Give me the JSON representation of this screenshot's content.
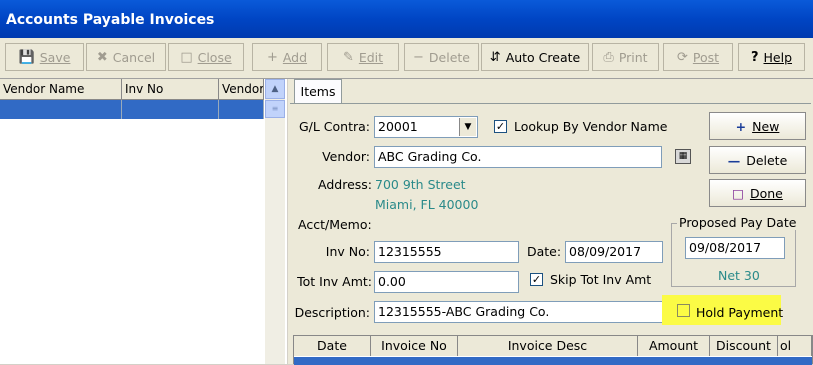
{
  "window": {
    "title": "Accounts Payable Invoices"
  },
  "toolbar": {
    "buttons": [
      {
        "label": "Save",
        "icon": "floppy-icon",
        "enabled": false
      },
      {
        "label": "Cancel",
        "icon": "cancel-x-icon",
        "enabled": false
      },
      {
        "label": "Close",
        "icon": "door-exit-icon",
        "enabled": false
      },
      {
        "label": "Add",
        "icon": "plus-icon",
        "enabled": false
      },
      {
        "label": "Edit",
        "icon": "edit-icon",
        "enabled": false
      },
      {
        "label": "Delete",
        "icon": "minus-icon",
        "enabled": false
      },
      {
        "label": "Auto Create",
        "icon": "auto-create-icon",
        "enabled": true
      },
      {
        "label": "Print",
        "icon": "printer-icon",
        "enabled": false
      },
      {
        "label": "Post",
        "icon": "post-icon",
        "enabled": false
      },
      {
        "label": "Help",
        "icon": "question-icon",
        "enabled": true
      }
    ]
  },
  "list": {
    "columns": [
      "Vendor Name",
      "Inv No",
      "Vendor"
    ]
  },
  "tabs": [
    "Items"
  ],
  "form": {
    "gl_contra_label": "G/L Contra:",
    "gl_contra_value": "20001",
    "lookup_label": "Lookup By Vendor Name",
    "lookup_checked": true,
    "vendor_label": "Vendor:",
    "vendor_value": "ABC Grading Co.",
    "address_label": "Address:",
    "address_line1": "700 9th Street",
    "address_line2": "Miami, FL 40000",
    "acct_memo_label": "Acct/Memo:",
    "inv_no_label": "Inv No:",
    "inv_no_value": "12315555",
    "date_label": "Date:",
    "date_value": "08/09/2017",
    "tot_inv_amt_label": "Tot Inv Amt:",
    "tot_inv_amt_value": "0.00",
    "skip_label": "Skip Tot Inv Amt",
    "skip_checked": true,
    "description_label": "Description:",
    "description_value": "12315555-ABC Grading Co.",
    "hold_label": "Hold Payment",
    "hold_checked": false
  },
  "side_buttons": {
    "new": "New",
    "delete": "Delete",
    "done": "Done"
  },
  "proposed": {
    "title": "Proposed Pay Date",
    "date": "09/08/2017",
    "terms": "Net 30"
  },
  "items_grid": {
    "columns": [
      "Date",
      "Invoice No",
      "Invoice Desc",
      "Amount",
      "Discount",
      "ol"
    ]
  },
  "colors": {
    "title_bar": "#0054e3",
    "selection": "#316ac5",
    "highlight": "#fbfb45",
    "address_text": "#2a8a8a"
  }
}
